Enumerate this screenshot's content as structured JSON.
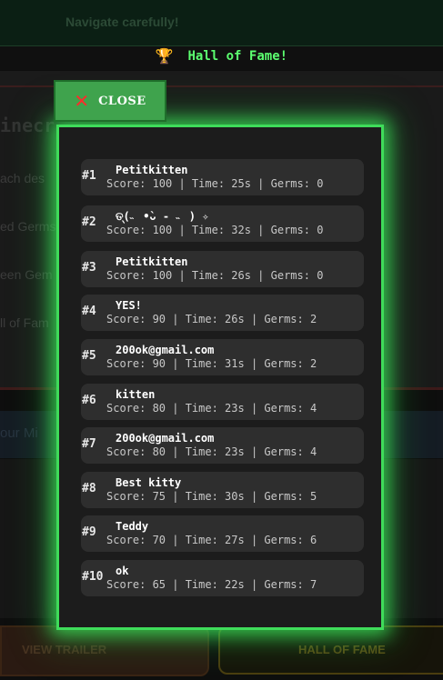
{
  "background": {
    "hint": "Navigate carefully!",
    "banner_icon": "trophy-icon",
    "banner_text": "Hall of Fame!",
    "heading_partial": "inecr",
    "labels": [
      "ach des",
      "ed Germs",
      "een Gem",
      "ll of Fam"
    ],
    "strip_text": "our Mi",
    "view_trailer": "VIEW TRAILER",
    "hall_of_fame_button": "HALL OF FAME"
  },
  "modal": {
    "close_label": "CLOSE",
    "close_icon": "close-x-icon",
    "accent_color": "#3fdc5a",
    "entries": [
      {
        "rank": "#1",
        "name": "Petitkitten",
        "stats": "Score: 100 | Time: 25s | Germs: 0"
      },
      {
        "rank": "#2",
        "name": "ତ୍(˵ •̀ᴗ - ˵ ) ✧",
        "stats": "Score: 100 | Time: 32s | Germs: 0"
      },
      {
        "rank": "#3",
        "name": "Petitkitten",
        "stats": "Score: 100 | Time: 26s | Germs: 0"
      },
      {
        "rank": "#4",
        "name": "YES!",
        "stats": "Score: 90 | Time: 26s | Germs: 2"
      },
      {
        "rank": "#5",
        "name": "200ok@gmail.com",
        "stats": "Score: 90 | Time: 31s | Germs: 2"
      },
      {
        "rank": "#6",
        "name": "kitten",
        "stats": "Score: 80 | Time: 23s | Germs: 4"
      },
      {
        "rank": "#7",
        "name": "200ok@gmail.com",
        "stats": "Score: 80 | Time: 23s | Germs: 4"
      },
      {
        "rank": "#8",
        "name": "Best kitty",
        "stats": "Score: 75 | Time: 30s | Germs: 5"
      },
      {
        "rank": "#9",
        "name": "Teddy",
        "stats": "Score: 70 | Time: 27s | Germs: 6"
      },
      {
        "rank": "#10",
        "name": "ok",
        "stats": "Score: 65 | Time: 22s | Germs: 7"
      }
    ]
  }
}
